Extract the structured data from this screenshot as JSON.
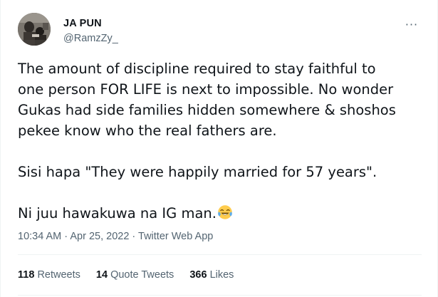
{
  "author": {
    "display_name": "JA PUN",
    "handle": "@RamzZy_",
    "avatar_icon": "profile-photo"
  },
  "menu": {
    "more_icon": "ellipsis-icon",
    "more_glyph": "···"
  },
  "tweet": {
    "lines": [
      "The amount of discipline required to stay faithful to",
      "one person FOR LIFE is next to impossible. No wonder",
      "Gukas had side families hidden somewhere & shoshos",
      "pekee know who the real fathers are."
    ],
    "second_paragraph": "Sisi hapa \"They were happily married for 57 years\".",
    "third_paragraph": "Ni juu hawakuwa na IG man.",
    "emoji": "face-with-tears-of-joy"
  },
  "meta": {
    "time": "10:34 AM",
    "separator": " · ",
    "date": "Apr 25, 2022",
    "source": "Twitter Web App"
  },
  "stats": {
    "retweets_count": "118",
    "retweets_label": "Retweets",
    "quotes_count": "14",
    "quotes_label": "Quote Tweets",
    "likes_count": "366",
    "likes_label": "Likes"
  },
  "colors": {
    "primary_text": "#0f1419",
    "secondary_text": "#536471",
    "divider": "#eff3f4"
  }
}
